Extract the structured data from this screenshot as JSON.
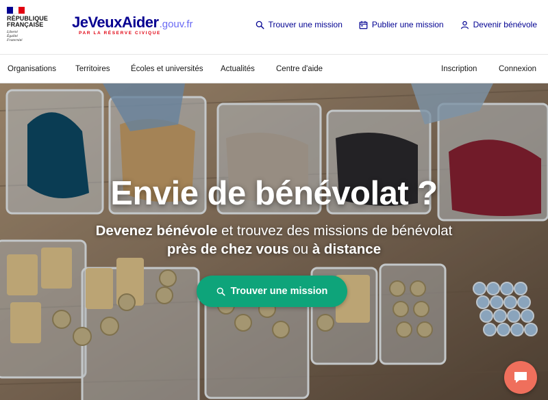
{
  "header": {
    "gov_logo": {
      "lines": [
        "RÉPUBLIQUE",
        "FRANÇAISE"
      ],
      "motto": [
        "Liberté",
        "Égalité",
        "Fraternité"
      ],
      "flag_colors": [
        "#000091",
        "#ffffff",
        "#e1000f"
      ]
    },
    "brand": {
      "name": "JeVeuxAider",
      "suffix": ".gouv.fr",
      "tagline": "PAR LA RÉSERVE CIVIQUE",
      "color": "#070191"
    },
    "quick_links": [
      {
        "label": "Trouver une mission",
        "icon": "search-icon"
      },
      {
        "label": "Publier une mission",
        "icon": "calendar-icon"
      },
      {
        "label": "Devenir bénévole",
        "icon": "user-icon"
      }
    ]
  },
  "nav": {
    "left": [
      {
        "label": "Organisations"
      },
      {
        "label": "Territoires"
      },
      {
        "label": "Écoles et universités"
      },
      {
        "label": "Actualités"
      },
      {
        "label": "Centre d'aide"
      }
    ],
    "right": [
      {
        "label": "Inscription"
      },
      {
        "label": "Connexion"
      }
    ]
  },
  "hero": {
    "title": "Envie de bénévolat ?",
    "subtitle_line1": {
      "bold": "Devenez bénévole",
      "rest": " et trouvez des missions de bénévolat"
    },
    "subtitle_line2": {
      "bold1": "près de chez vous",
      "mid": " ou ",
      "bold2": "à distance"
    },
    "cta_label": "Trouver une mission",
    "cta_color": "#0ea47a"
  },
  "chat": {
    "icon": "chat-icon",
    "color": "#ef6f5c"
  }
}
